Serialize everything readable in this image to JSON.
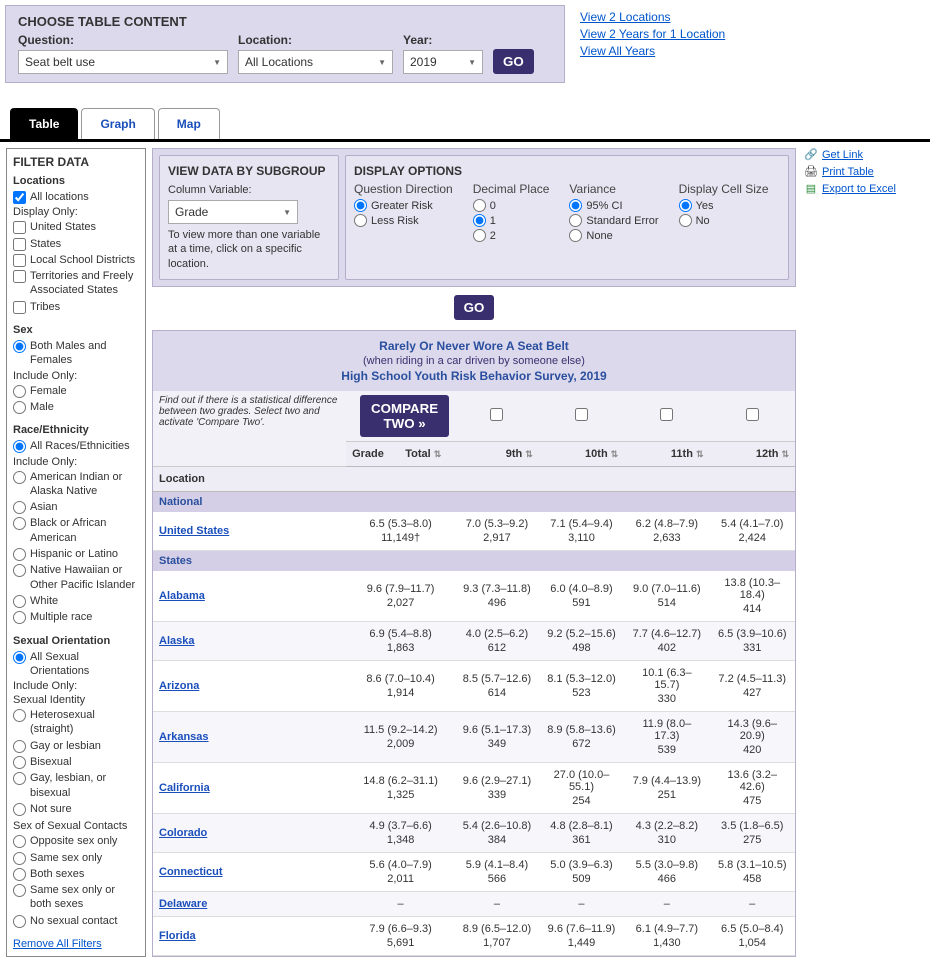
{
  "choose": {
    "title": "CHOOSE TABLE CONTENT",
    "question_label": "Question:",
    "question_value": "Seat belt use",
    "location_label": "Location:",
    "location_value": "All Locations",
    "year_label": "Year:",
    "year_value": "2019",
    "go": "GO"
  },
  "top_links": {
    "l1": "View 2 Locations",
    "l2": "View 2 Years for 1 Location",
    "l3": "View All Years"
  },
  "tabs": {
    "table": "Table",
    "graph": "Graph",
    "map": "Map"
  },
  "sidebar": {
    "title": "FILTER DATA",
    "locations": {
      "heading": "Locations",
      "all": "All locations",
      "display_only": "Display Only:",
      "items": [
        "United States",
        "States",
        "Local School Districts",
        "Territories and Freely Associated States",
        "Tribes"
      ]
    },
    "sex": {
      "heading": "Sex",
      "both": "Both Males and Females",
      "include_only": "Include Only:",
      "items": [
        "Female",
        "Male"
      ]
    },
    "race": {
      "heading": "Race/Ethnicity",
      "all": "All Races/Ethnicities",
      "include_only": "Include Only:",
      "items": [
        "American Indian or Alaska Native",
        "Asian",
        "Black or African American",
        "Hispanic or Latino",
        "Native Hawaiian or Other Pacific Islander",
        "White",
        "Multiple race"
      ]
    },
    "orientation": {
      "heading": "Sexual Orientation",
      "all": "All Sexual Orientations",
      "include_only": "Include Only:",
      "identity_label": "Sexual Identity",
      "identity_items": [
        "Heterosexual (straight)",
        "Gay or lesbian",
        "Bisexual",
        "Gay, lesbian, or bisexual",
        "Not sure"
      ],
      "contacts_label": "Sex of Sexual Contacts",
      "contacts_items": [
        "Opposite sex only",
        "Same sex only",
        "Both sexes",
        "Same sex only or both sexes",
        "No sexual contact"
      ]
    },
    "remove": "Remove All Filters"
  },
  "subgroup": {
    "title": "VIEW DATA BY SUBGROUP",
    "col_var_label": "Column Variable:",
    "col_var_value": "Grade",
    "hint": "To view more than one variable at a time, click on a specific location."
  },
  "display": {
    "title": "DISPLAY OPTIONS",
    "direction": {
      "label": "Question Direction",
      "greater": "Greater Risk",
      "less": "Less Risk"
    },
    "decimal": {
      "label": "Decimal Place",
      "d0": "0",
      "d1": "1",
      "d2": "2"
    },
    "variance": {
      "label": "Variance",
      "ci": "95% CI",
      "se": "Standard Error",
      "none": "None"
    },
    "cell": {
      "label": "Display Cell Size",
      "yes": "Yes",
      "no": "No"
    },
    "go": "GO"
  },
  "share": {
    "get_link": "Get Link",
    "print": "Print Table",
    "excel": "Export to Excel"
  },
  "table": {
    "title1": "Rarely Or Never Wore A Seat Belt",
    "title2": "(when riding in a car driven by someone else)",
    "title3": "High School Youth Risk Behavior Survey, 2019",
    "compare_note": "Find out if there is a statistical difference between two grades. Select two and activate 'Compare Two'.",
    "compare_btn": "COMPARE TWO »",
    "col_grade": "Grade",
    "col_location": "Location",
    "cols": [
      "Total",
      "9th",
      "10th",
      "11th",
      "12th"
    ],
    "sec_national": "National",
    "sec_states": "States",
    "rows": [
      {
        "section": "National"
      },
      {
        "name": "United States",
        "cells": [
          [
            "6.5 (5.3–8.0)",
            "11,149†"
          ],
          [
            "7.0 (5.3–9.2)",
            "2,917"
          ],
          [
            "7.1 (5.4–9.4)",
            "3,110"
          ],
          [
            "6.2 (4.8–7.9)",
            "2,633"
          ],
          [
            "5.4 (4.1–7.0)",
            "2,424"
          ]
        ]
      },
      {
        "section": "States"
      },
      {
        "name": "Alabama",
        "cells": [
          [
            "9.6 (7.9–11.7)",
            "2,027"
          ],
          [
            "9.3 (7.3–11.8)",
            "496"
          ],
          [
            "6.0 (4.0–8.9)",
            "591"
          ],
          [
            "9.0 (7.0–11.6)",
            "514"
          ],
          [
            "13.8 (10.3–18.4)",
            "414"
          ]
        ]
      },
      {
        "name": "Alaska",
        "cells": [
          [
            "6.9 (5.4–8.8)",
            "1,863"
          ],
          [
            "4.0 (2.5–6.2)",
            "612"
          ],
          [
            "9.2 (5.2–15.6)",
            "498"
          ],
          [
            "7.7 (4.6–12.7)",
            "402"
          ],
          [
            "6.5 (3.9–10.6)",
            "331"
          ]
        ]
      },
      {
        "name": "Arizona",
        "cells": [
          [
            "8.6 (7.0–10.4)",
            "1,914"
          ],
          [
            "8.5 (5.7–12.6)",
            "614"
          ],
          [
            "8.1 (5.3–12.0)",
            "523"
          ],
          [
            "10.1 (6.3–15.7)",
            "330"
          ],
          [
            "7.2 (4.5–11.3)",
            "427"
          ]
        ]
      },
      {
        "name": "Arkansas",
        "cells": [
          [
            "11.5 (9.2–14.2)",
            "2,009"
          ],
          [
            "9.6 (5.1–17.3)",
            "349"
          ],
          [
            "8.9 (5.8–13.6)",
            "672"
          ],
          [
            "11.9 (8.0–17.3)",
            "539"
          ],
          [
            "14.3 (9.6–20.9)",
            "420"
          ]
        ]
      },
      {
        "name": "California",
        "cells": [
          [
            "14.8 (6.2–31.1)",
            "1,325"
          ],
          [
            "9.6 (2.9–27.1)",
            "339"
          ],
          [
            "27.0 (10.0–55.1)",
            "254"
          ],
          [
            "7.9 (4.4–13.9)",
            "251"
          ],
          [
            "13.6 (3.2–42.6)",
            "475"
          ]
        ]
      },
      {
        "name": "Colorado",
        "cells": [
          [
            "4.9 (3.7–6.6)",
            "1,348"
          ],
          [
            "5.4 (2.6–10.8)",
            "384"
          ],
          [
            "4.8 (2.8–8.1)",
            "361"
          ],
          [
            "4.3 (2.2–8.2)",
            "310"
          ],
          [
            "3.5 (1.8–6.5)",
            "275"
          ]
        ]
      },
      {
        "name": "Connecticut",
        "cells": [
          [
            "5.6 (4.0–7.9)",
            "2,011"
          ],
          [
            "5.9 (4.1–8.4)",
            "566"
          ],
          [
            "5.0 (3.9–6.3)",
            "509"
          ],
          [
            "5.5 (3.0–9.8)",
            "466"
          ],
          [
            "5.8 (3.1–10.5)",
            "458"
          ]
        ]
      },
      {
        "name": "Delaware",
        "cells": [
          [
            "–",
            ""
          ],
          [
            "–",
            ""
          ],
          [
            "–",
            ""
          ],
          [
            "–",
            ""
          ],
          [
            "–",
            ""
          ]
        ]
      },
      {
        "name": "Florida",
        "cells": [
          [
            "7.9 (6.6–9.3)",
            "5,691"
          ],
          [
            "8.9 (6.5–12.0)",
            "1,707"
          ],
          [
            "9.6 (7.6–11.9)",
            "1,449"
          ],
          [
            "6.1 (4.9–7.7)",
            "1,430"
          ],
          [
            "6.5 (5.0–8.4)",
            "1,054"
          ]
        ]
      }
    ]
  }
}
